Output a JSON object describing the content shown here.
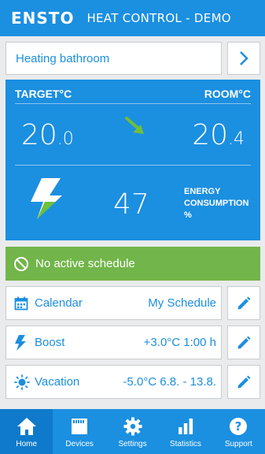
{
  "header": {
    "logo": "ENSTO",
    "title": "HEAT CONTROL - DEMO"
  },
  "device": {
    "name": "Heating bathroom"
  },
  "panel": {
    "target_label": "TARGET°C",
    "room_label": "ROOM°C",
    "target_int": "20",
    "target_dec": ".0",
    "room_int": "20",
    "room_dec": ".4",
    "energy_value": "47",
    "energy_label_1": "ENERGY",
    "energy_label_2": "CONSUMPTION",
    "energy_unit": "%"
  },
  "schedule": {
    "status": "No active schedule"
  },
  "rows": {
    "calendar": {
      "label": "Calendar",
      "value": "My Schedule"
    },
    "boost": {
      "label": "Boost",
      "value": "+3.0°C 1:00 h"
    },
    "vacation": {
      "label": "Vacation",
      "value": "-5.0°C 6.8. - 13.8."
    }
  },
  "nav": {
    "home": "Home",
    "devices": "Devices",
    "settings": "Settings",
    "statistics": "Statistics",
    "support": "Support"
  },
  "colors": {
    "primary": "#1b8fe0",
    "active_nav": "#0f7acb",
    "schedule_green": "#72b54a",
    "trend_arrow": "#6fbf3c"
  }
}
